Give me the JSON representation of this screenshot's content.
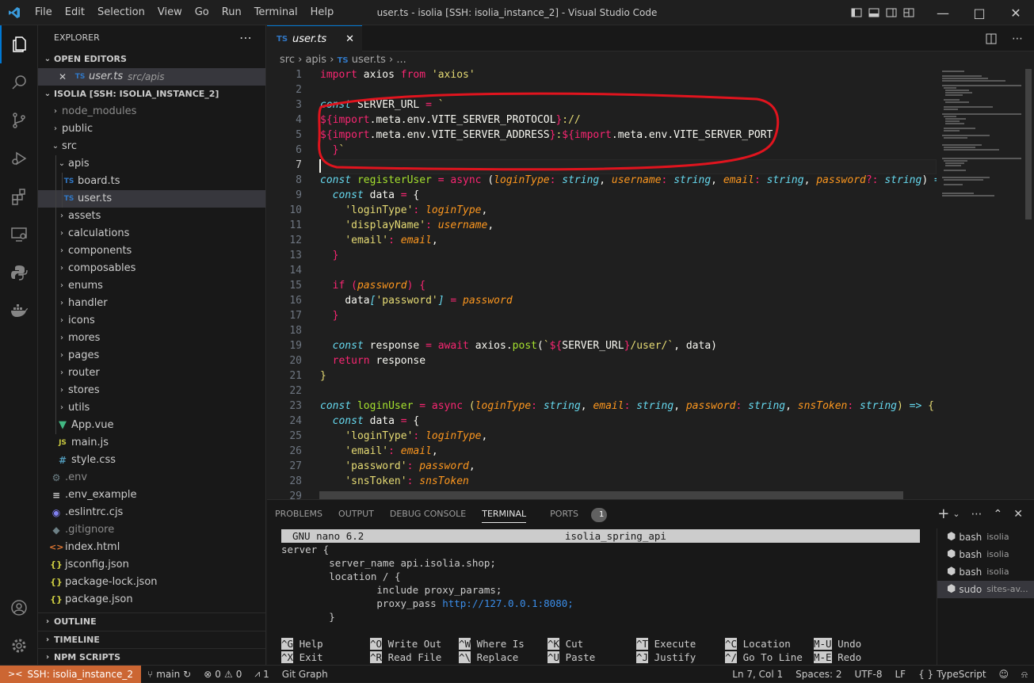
{
  "window": {
    "title": "user.ts - isolia [SSH: isolia_instance_2] - Visual Studio Code"
  },
  "menu": [
    "File",
    "Edit",
    "Selection",
    "View",
    "Go",
    "Run",
    "Terminal",
    "Help"
  ],
  "sidebar": {
    "title": "EXPLORER",
    "open_editors": {
      "label": "OPEN EDITORS",
      "items": [
        {
          "name": "user.ts",
          "path": "src/apis"
        }
      ]
    },
    "workspace": {
      "label": "ISOLIA [SSH: ISOLIA_INSTANCE_2]"
    },
    "tree": [
      {
        "label": "node_modules"
      },
      {
        "label": "public"
      },
      {
        "label": "src"
      },
      {
        "label": "apis"
      },
      {
        "label": "board.ts"
      },
      {
        "label": "user.ts"
      },
      {
        "label": "assets"
      },
      {
        "label": "calculations"
      },
      {
        "label": "components"
      },
      {
        "label": "composables"
      },
      {
        "label": "enums"
      },
      {
        "label": "handler"
      },
      {
        "label": "icons"
      },
      {
        "label": "mores"
      },
      {
        "label": "pages"
      },
      {
        "label": "router"
      },
      {
        "label": "stores"
      },
      {
        "label": "utils"
      },
      {
        "label": "App.vue"
      },
      {
        "label": "main.js"
      },
      {
        "label": "style.css"
      },
      {
        "label": ".env"
      },
      {
        "label": ".env_example"
      },
      {
        "label": ".eslintrc.cjs"
      },
      {
        "label": ".gitignore"
      },
      {
        "label": "index.html"
      },
      {
        "label": "jsconfig.json"
      },
      {
        "label": "package-lock.json"
      },
      {
        "label": "package.json"
      }
    ],
    "sections": [
      "OUTLINE",
      "TIMELINE",
      "NPM SCRIPTS"
    ]
  },
  "editor": {
    "tab": "user.ts",
    "breadcrumb": {
      "folder1": "src",
      "folder2": "apis",
      "file": "user.ts",
      "more": "..."
    },
    "cursor_line": 7
  },
  "panel": {
    "tabs": [
      "PROBLEMS",
      "OUTPUT",
      "DEBUG CONSOLE",
      "TERMINAL",
      "PORTS"
    ],
    "ports_badge": "1",
    "nano": {
      "version": "GNU nano 6.2",
      "filename": "isolia_spring_api",
      "lines": [
        "server {",
        "        server_name api.isolia.shop;",
        "        location / {",
        "                include proxy_params;",
        "                proxy_pass ",
        "        }"
      ],
      "proxy_url": "http://127.0.0.1:8080;",
      "shortcuts_row1": [
        [
          "^G",
          "Help"
        ],
        [
          "^O",
          "Write Out"
        ],
        [
          "^W",
          "Where Is"
        ],
        [
          "^K",
          "Cut"
        ],
        [
          "^T",
          "Execute"
        ],
        [
          "^C",
          "Location"
        ],
        [
          "M-U",
          "Undo"
        ]
      ],
      "shortcuts_row2": [
        [
          "^X",
          "Exit"
        ],
        [
          "^R",
          "Read File"
        ],
        [
          "^\\",
          "Replace"
        ],
        [
          "^U",
          "Paste"
        ],
        [
          "^J",
          "Justify"
        ],
        [
          "^/",
          "Go To Line"
        ],
        [
          "M-E",
          "Redo"
        ]
      ]
    },
    "terminals": [
      {
        "name": "bash",
        "cwd": "isolia"
      },
      {
        "name": "bash",
        "cwd": "isolia"
      },
      {
        "name": "bash",
        "cwd": "isolia"
      },
      {
        "name": "sudo",
        "cwd": "sites-av..."
      }
    ]
  },
  "statusbar": {
    "remote": "SSH: isolia_instance_2",
    "branch": "main",
    "errors": "0",
    "warnings": "0",
    "ports": "1",
    "git_graph": "Git Graph",
    "position": "Ln 7, Col 1",
    "spaces": "Spaces: 2",
    "encoding": "UTF-8",
    "eol": "LF",
    "language": "TypeScript"
  },
  "colors": {
    "accent": "#0078d4",
    "remote": "#cc6633",
    "annotation": "#e0141e"
  }
}
